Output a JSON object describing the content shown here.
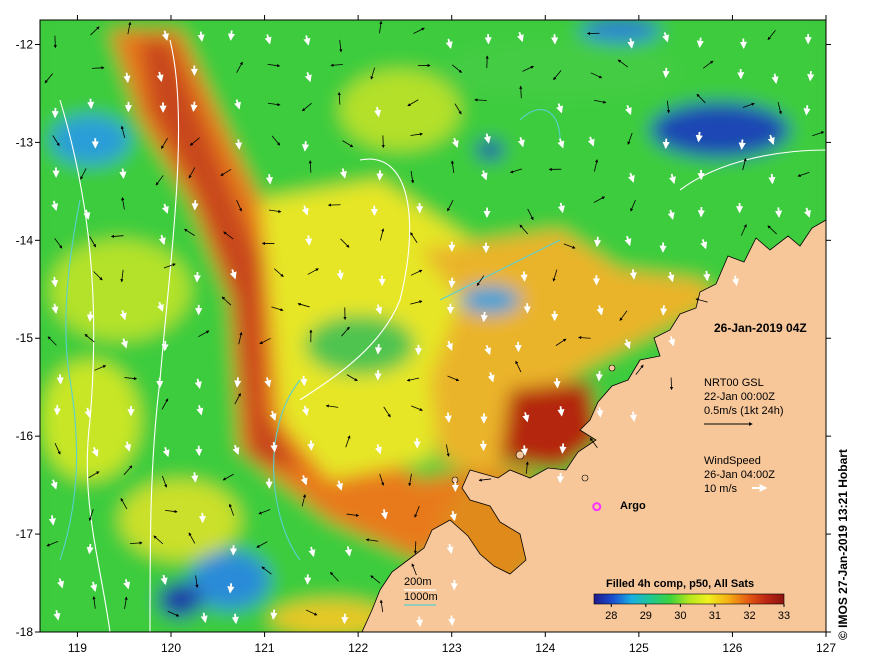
{
  "map": {
    "date_label": "26-Jan-2019 04Z",
    "x_ticks": [
      "119",
      "120",
      "121",
      "122",
      "123",
      "124",
      "125",
      "126",
      "127"
    ],
    "y_ticks": [
      "-12",
      "-13",
      "-14",
      "-15",
      "-16",
      "-17",
      "-18"
    ],
    "lon_range": [
      118.6,
      127
    ],
    "lat_range": [
      -18,
      -11.75
    ],
    "land_color": "#f7c79a",
    "water_shallow_color": "#5ad0d0"
  },
  "current_legend": {
    "line1": "NRT00 GSL",
    "line2": "22-Jan 00:00Z",
    "line3": "0.5m/s (1kt 24h)"
  },
  "wind_legend": {
    "line1": "WindSpeed",
    "line2": "26-Jan 04:00Z",
    "line3": "10 m/s"
  },
  "argo": {
    "label": "Argo",
    "color": "#ff33ff",
    "lon": 124.55,
    "lat": -16.72
  },
  "depth_legend": {
    "label1": "200m",
    "label2": "1000m"
  },
  "colorbar": {
    "title": "Filled 4h comp, p50, All Sats",
    "ticks": [
      "28",
      "29",
      "30",
      "31",
      "32",
      "33"
    ],
    "tick_values": [
      28,
      29,
      30,
      31,
      32,
      33
    ],
    "range": [
      27.5,
      33
    ],
    "colors": [
      "#1f1a8c",
      "#1a4fd0",
      "#1ab0e0",
      "#20c890",
      "#3cd23c",
      "#b4e61e",
      "#f0f01e",
      "#f5b414",
      "#e86414",
      "#c02814",
      "#8c1410"
    ]
  },
  "credit": "© IMOS 27-Jan-2019 13:21 Hobart"
}
